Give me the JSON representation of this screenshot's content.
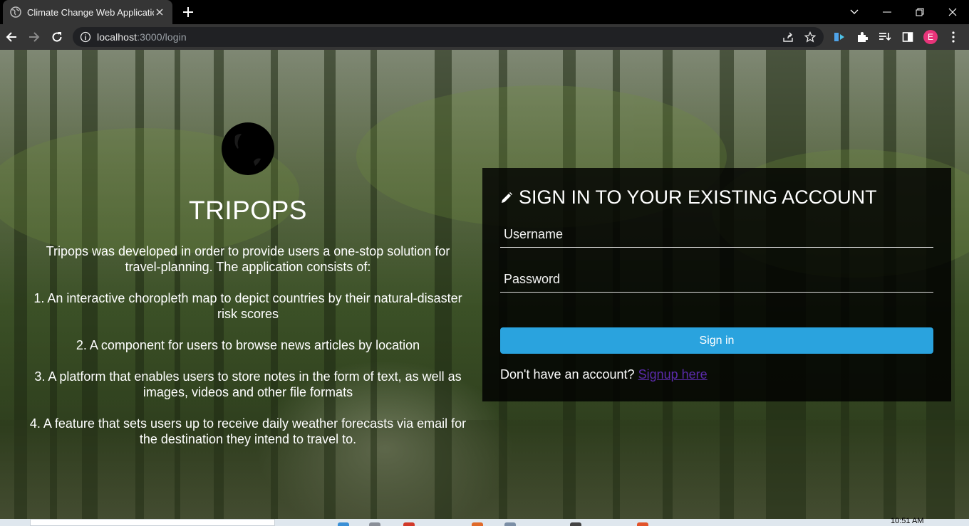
{
  "browser": {
    "tab_title": "Climate Change Web Application",
    "url_host": "localhost",
    "url_path": ":3000/login",
    "profile_initial": "E",
    "icons": {
      "favicon": "globe-icon",
      "close": "close-icon",
      "new_tab": "plus-icon",
      "back": "arrow-left-icon",
      "forward": "arrow-right-icon",
      "reload": "reload-icon",
      "site_info": "info-icon",
      "share": "share-icon",
      "bookmark": "star-icon",
      "extensions": "puzzle-icon",
      "reading_list": "reading-list-icon",
      "side_panel": "side-panel-icon",
      "menu": "kebab-menu-icon"
    }
  },
  "brand": {
    "name": "TRIPOPS",
    "logo_icon": "globe-icon"
  },
  "description": {
    "intro": "Tripops was developed in order to provide users a one-stop solution for travel-planning. The application consists of:",
    "features": [
      "1. An interactive choropleth map to depict countries by their natural-disaster risk scores",
      "2. A component for users to browse news articles by location",
      "3. A platform that enables users to store notes in the form of text, as well as images, videos and other file formats",
      "4. A feature that sets users up to receive daily weather forecasts via email for the destination they intend to travel to."
    ]
  },
  "login": {
    "title": "SIGN IN TO YOUR EXISTING ACCOUNT",
    "username_placeholder": "Username",
    "password_placeholder": "Password",
    "submit_label": "Sign in",
    "signup_prompt": "Don't have an account?",
    "signup_link": "Signup here"
  },
  "taskbar": {
    "clock": "10:51 AM"
  },
  "colors": {
    "button": "#2aa3de",
    "link": "#5b2bab",
    "panel": "rgba(0,0,0,0.82)",
    "profile": "#e8347a"
  }
}
